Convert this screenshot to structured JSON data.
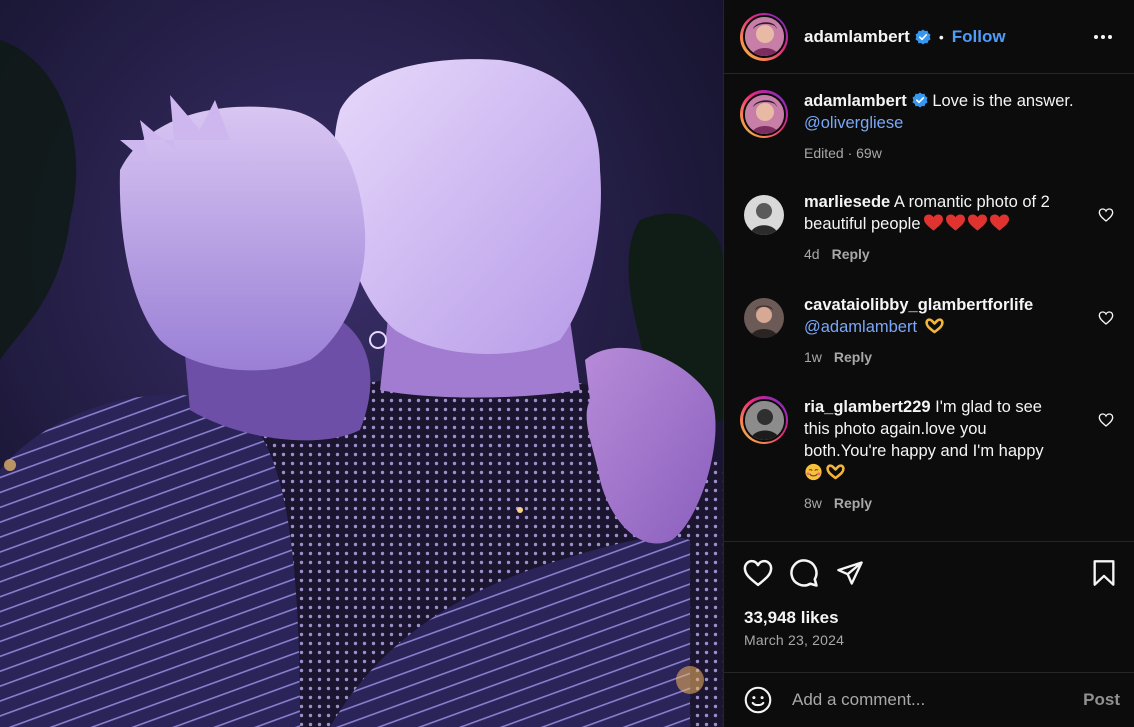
{
  "post": {
    "author": "adamlambert",
    "follow_label": "Follow",
    "separator": "•",
    "caption": {
      "username": "adamlambert",
      "text": "Love is the answer.",
      "mention": "@olivergliese",
      "meta": "Edited · 69w"
    },
    "likes": "33,948 likes",
    "date": "March 23, 2024"
  },
  "comments": [
    {
      "username": "marliesede",
      "text": "A romantic photo of 2 beautiful people",
      "emoji": [
        "red-heart",
        "red-heart",
        "red-heart",
        "red-heart"
      ],
      "age": "4d",
      "reply_label": "Reply"
    },
    {
      "username": "cavataiolibby_glambertforlife",
      "text": "@adamlambert",
      "emoji": [
        "heart-hands"
      ],
      "age": "1w",
      "reply_label": "Reply"
    },
    {
      "username": "ria_glambert229",
      "text": "I'm glad to see this photo again.love you both.You're happy and I'm happy",
      "emoji": [
        "smiling-face-with-hearts",
        "heart-hands"
      ],
      "age": "8w",
      "reply_label": "Reply"
    }
  ],
  "comment_box": {
    "placeholder": "Add a comment...",
    "post_label": "Post"
  },
  "icons": {
    "like": "heart-outline-icon",
    "comment": "comment-bubble-icon",
    "share": "paper-plane-icon",
    "save": "bookmark-icon",
    "more": "more-horizontal-icon",
    "emoji": "emoji-smile-icon",
    "verified": "verified-badge-icon"
  },
  "colors": {
    "follow": "#4f9cf9",
    "mention": "#7aa7f7",
    "verified": "#3797f0",
    "panel_bg": "#0c0c0c",
    "secondary_text": "#a8a8a8"
  }
}
